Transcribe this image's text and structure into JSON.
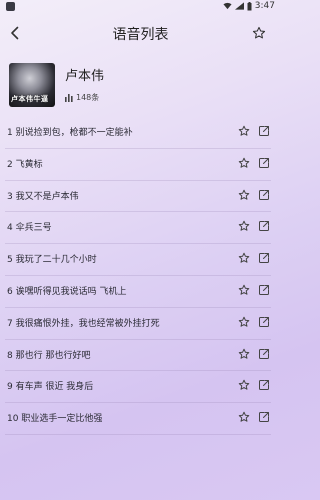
{
  "status": {
    "time": "3:47"
  },
  "header": {
    "title": "语音列表"
  },
  "artist": {
    "name": "卢本伟",
    "count": "148条",
    "avatar_caption": "卢本伟牛逼"
  },
  "songs": [
    {
      "title": "1  别说捡到包，枪都不一定能补"
    },
    {
      "title": "2  飞黄标"
    },
    {
      "title": "3  我又不是卢本伟"
    },
    {
      "title": "4  伞兵三号"
    },
    {
      "title": "5  我玩了二十几个小时"
    },
    {
      "title": "6  诶嘿听得见我说话吗 飞机上"
    },
    {
      "title": "7  我很痛恨外挂，我也经常被外挂打死"
    },
    {
      "title": "8  那也行 那也行好吧"
    },
    {
      "title": "9  有车声 很近 我身后"
    },
    {
      "title": "10  职业选手一定比他强"
    }
  ],
  "icons": {
    "back": "chevron-left-icon",
    "favorite": "star-outline-icon",
    "share": "share-icon",
    "count": "bar-chart-icon"
  },
  "colors": {
    "accent": "#d5c4f1",
    "text": "#2b2b35"
  }
}
